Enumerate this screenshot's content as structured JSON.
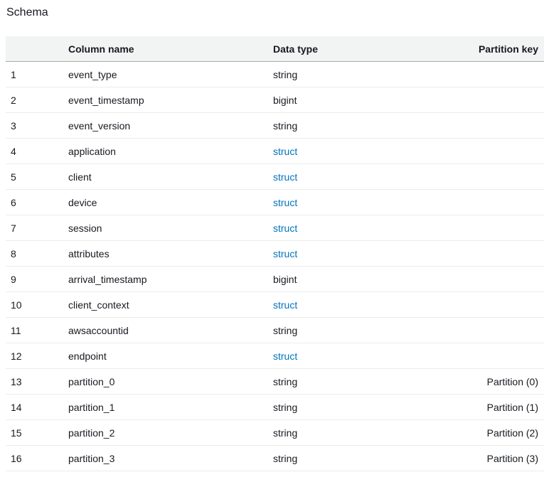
{
  "schema": {
    "title": "Schema",
    "headers": {
      "num": "",
      "column_name": "Column name",
      "data_type": "Data type",
      "partition_key": "Partition key"
    },
    "rows": [
      {
        "num": "1",
        "name": "event_type",
        "type": "string",
        "partition": ""
      },
      {
        "num": "2",
        "name": "event_timestamp",
        "type": "bigint",
        "partition": ""
      },
      {
        "num": "3",
        "name": "event_version",
        "type": "string",
        "partition": ""
      },
      {
        "num": "4",
        "name": "application",
        "type": "struct",
        "partition": ""
      },
      {
        "num": "5",
        "name": "client",
        "type": "struct",
        "partition": ""
      },
      {
        "num": "6",
        "name": "device",
        "type": "struct",
        "partition": ""
      },
      {
        "num": "7",
        "name": "session",
        "type": "struct",
        "partition": ""
      },
      {
        "num": "8",
        "name": "attributes",
        "type": "struct",
        "partition": ""
      },
      {
        "num": "9",
        "name": "arrival_timestamp",
        "type": "bigint",
        "partition": ""
      },
      {
        "num": "10",
        "name": "client_context",
        "type": "struct",
        "partition": ""
      },
      {
        "num": "11",
        "name": "awsaccountid",
        "type": "string",
        "partition": ""
      },
      {
        "num": "12",
        "name": "endpoint",
        "type": "struct",
        "partition": ""
      },
      {
        "num": "13",
        "name": "partition_0",
        "type": "string",
        "partition": "Partition (0)"
      },
      {
        "num": "14",
        "name": "partition_1",
        "type": "string",
        "partition": "Partition (1)"
      },
      {
        "num": "15",
        "name": "partition_2",
        "type": "string",
        "partition": "Partition (2)"
      },
      {
        "num": "16",
        "name": "partition_3",
        "type": "string",
        "partition": "Partition (3)"
      }
    ]
  },
  "colors": {
    "link": "#0073bb",
    "header_bg": "#f2f3f3"
  }
}
